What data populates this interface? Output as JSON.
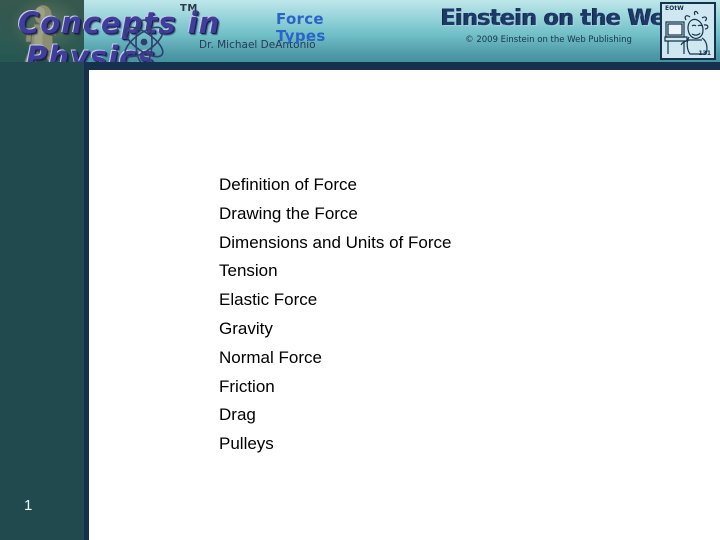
{
  "slide": {
    "page_number": "1",
    "background_color": "#ffffff"
  },
  "header": {
    "brand": {
      "wordmark_line1": "Concepts in",
      "wordmark_line2": "Physics",
      "trademark": "TM",
      "statue_icon": "thinker-statue-icon",
      "atom_icon": "atom-icon"
    },
    "author": "Dr. Michael\nDeAntonio",
    "title": "Force\nTypes",
    "title_color": "#2a64c8",
    "publisher": {
      "logo_text": "Einstein on the Web",
      "copyright": "© 2009 Einstein on the Web Publishing"
    },
    "einstein_box": {
      "tag": "EOtW",
      "number": "131",
      "icon": "einstein-at-computer-icon"
    },
    "gradient_top_color": "#bfe7ea",
    "gradient_bottom_color": "#47919f",
    "dark_bar_color": "#16314b"
  },
  "sidebar": {
    "background_color": "#204a4e",
    "stripe_color": "#16314b"
  },
  "content": {
    "topics": [
      "Definition of Force",
      "Drawing the Force",
      "Dimensions and Units of Force",
      "Tension",
      "Elastic Force",
      "Gravity",
      "Normal Force",
      "Friction",
      "Drag",
      "Pulleys"
    ]
  }
}
